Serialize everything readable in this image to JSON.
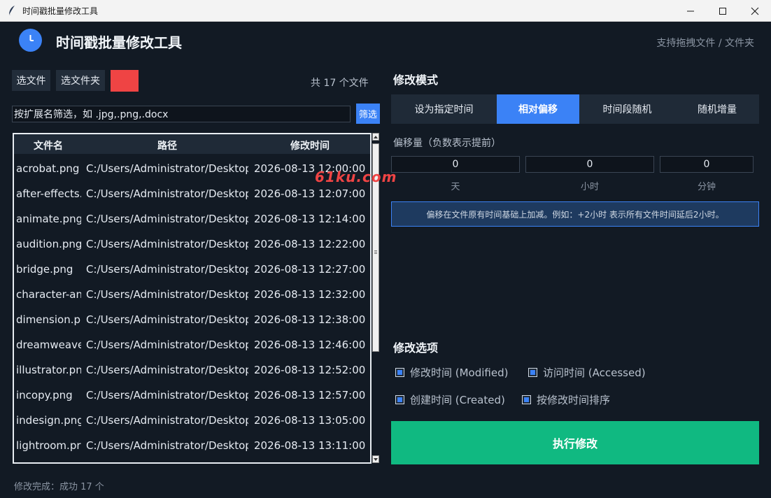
{
  "window": {
    "title": "时间戳批量修改工具"
  },
  "header": {
    "title": "时间戳批量修改工具",
    "drag_hint": "支持拖拽文件 / 文件夹"
  },
  "toolbar": {
    "select_file_label": "选文件",
    "select_folder_label": "选文件夹",
    "clear_color": "#ef4444",
    "file_count": "共 17 个文件"
  },
  "filter": {
    "placeholder": "按扩展名筛选，如 .jpg,.png,.docx",
    "button_label": "筛选"
  },
  "table": {
    "columns": [
      "文件名",
      "路径",
      "修改时间"
    ],
    "rows": [
      [
        "acrobat.png",
        "C:/Users/Administrator/Desktop",
        "2026-08-13 12:00:00"
      ],
      [
        "after-effects.",
        "C:/Users/Administrator/Desktop",
        "2026-08-13 12:07:00"
      ],
      [
        "animate.png",
        "C:/Users/Administrator/Desktop",
        "2026-08-13 12:14:00"
      ],
      [
        "audition.png",
        "C:/Users/Administrator/Desktop",
        "2026-08-13 12:22:00"
      ],
      [
        "bridge.png",
        "C:/Users/Administrator/Desktop",
        "2026-08-13 12:27:00"
      ],
      [
        "character-an",
        "C:/Users/Administrator/Desktop",
        "2026-08-13 12:32:00"
      ],
      [
        "dimension.pr",
        "C:/Users/Administrator/Desktop",
        "2026-08-13 12:38:00"
      ],
      [
        "dreamweave",
        "C:/Users/Administrator/Desktop",
        "2026-08-13 12:46:00"
      ],
      [
        "illustrator.pn",
        "C:/Users/Administrator/Desktop",
        "2026-08-13 12:52:00"
      ],
      [
        "incopy.png",
        "C:/Users/Administrator/Desktop",
        "2026-08-13 12:57:00"
      ],
      [
        "indesign.png",
        "C:/Users/Administrator/Desktop",
        "2026-08-13 13:05:00"
      ],
      [
        "lightroom.pr",
        "C:/Users/Administrator/Desktop",
        "2026-08-13 13:11:00"
      ]
    ]
  },
  "watermark": "61ku.com",
  "mode": {
    "title": "修改模式",
    "tabs": [
      "设为指定时间",
      "相对偏移",
      "时间段随机",
      "随机增量"
    ],
    "active_tab": "相对偏移",
    "offset_label": "偏移量（负数表示提前）",
    "days_value": "0",
    "hours_value": "0",
    "minutes_value": "0",
    "days_unit": "天",
    "hours_unit": "小时",
    "minutes_unit": "分钟",
    "info": "偏移在文件原有时间基础上加减。例如：+2小时 表示所有文件时间延后2小时。"
  },
  "options": {
    "title": "修改选项",
    "modified": "修改时间 (Modified)",
    "accessed": "访问时间 (Accessed)",
    "created": "创建时间 (Created)",
    "sort": "按修改时间排序",
    "modified_checked": true,
    "accessed_checked": true,
    "created_checked": true,
    "sort_checked": true
  },
  "execute_label": "执行修改",
  "status": "修改完成：成功 17 个"
}
